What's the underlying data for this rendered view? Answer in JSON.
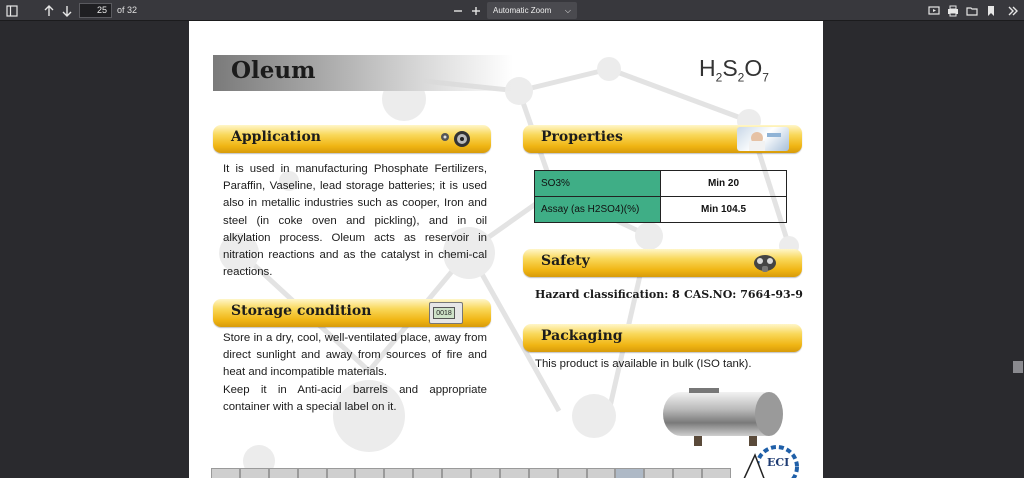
{
  "toolbar": {
    "page_number": "25",
    "page_count": "of 32",
    "zoom_value": "Automatic Zoom",
    "icons": [
      "sidebar-toggle-icon",
      "up-arrow-icon",
      "down-arrow-icon",
      "zoom-out-icon",
      "zoom-in-icon",
      "presentation-icon",
      "print-icon",
      "open-file-icon",
      "bookmark-icon",
      "more-tools-icon"
    ]
  },
  "document": {
    "title": "Oleum",
    "formula": {
      "h": "H",
      "h_sub": "2",
      "s": "S",
      "s_sub": "2",
      "o": "O",
      "o_sub": "7"
    },
    "application": {
      "heading": "Application",
      "text": "It is used in manufacturing Phosphate Fertilizers, Paraffin, Vaseline, lead storage batteries; it is used also in metallic industries such as cooper, Iron and steel (in coke oven and pickling), and in oil alkylation process. Oleum acts as reservoir in nitration reactions and as the catalyst in chemi-cal reactions."
    },
    "storage": {
      "heading": "Storage condition",
      "text1": "Store in a dry, cool, well-ventilated place, away from direct sunlight and away from sources of fire and heat and incompatible materials.",
      "text2": "Keep it in Anti-acid barrels and appropriate container with a special label on it.",
      "meter_reading": "0018"
    },
    "properties": {
      "heading": "Properties",
      "rows": [
        {
          "key": "SO3%",
          "value": "Min 20"
        },
        {
          "key": "Assay (as H2SO4)(%)",
          "value": "Min 104.5"
        }
      ]
    },
    "safety": {
      "heading": "Safety",
      "hazard": "Hazard classification: 8",
      "cas": "CAS.NO: 7664-93-9"
    },
    "packaging": {
      "heading": "Packaging",
      "text": "This product is available in bulk (ISO tank)."
    },
    "logo_text": "ECI"
  },
  "colors": {
    "banner_gold": "#f0b514",
    "table_green": "#3fae86",
    "toolbar_bg": "#38383d",
    "viewer_bg": "#2a2a2e"
  }
}
